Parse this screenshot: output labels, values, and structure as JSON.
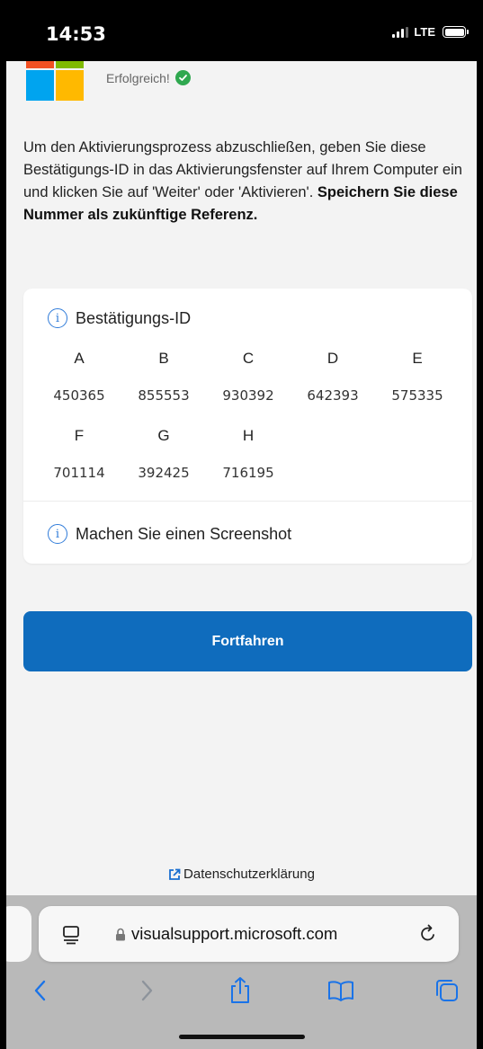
{
  "status_bar": {
    "time": "14:53",
    "network": "LTE"
  },
  "header": {
    "success_text": "Erfolgreich!"
  },
  "instructions": {
    "part1": "Um den Aktivierungsprozess abzuschließen, geben Sie diese Bestätigungs-ID in das Aktivierungsfenster auf Ihrem Computer ein und klicken Sie auf 'Weiter' oder 'Aktivieren'. ",
    "part2_bold": "Speichern Sie diese Nummer als zukünftige Referenz."
  },
  "card": {
    "title": "Bestätigungs-ID",
    "groups": [
      {
        "letter": "A",
        "value": "450365"
      },
      {
        "letter": "B",
        "value": "855553"
      },
      {
        "letter": "C",
        "value": "930392"
      },
      {
        "letter": "D",
        "value": "642393"
      },
      {
        "letter": "E",
        "value": "575335"
      },
      {
        "letter": "F",
        "value": "701114"
      },
      {
        "letter": "G",
        "value": "392425"
      },
      {
        "letter": "H",
        "value": "716195"
      }
    ],
    "screenshot_hint": "Machen Sie einen Screenshot"
  },
  "continue_button_label": "Fortfahren",
  "privacy_link": "Datenschutzerklärung",
  "browser": {
    "url": "visualsupport.microsoft.com"
  },
  "colors": {
    "primary_button": "#0f6cbd",
    "info_icon": "#2f7bd9",
    "success": "#2fa84f"
  }
}
